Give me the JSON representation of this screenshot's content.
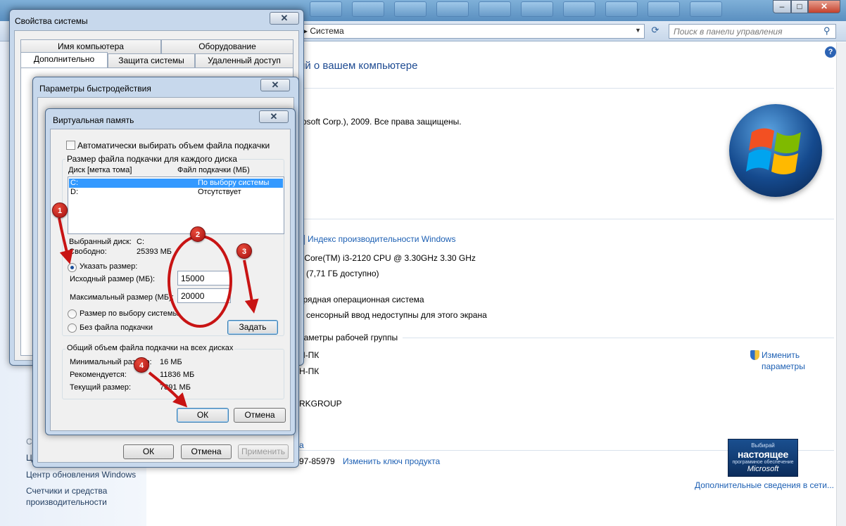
{
  "control_panel": {
    "address_breadcrumb": "▸ Система",
    "search_placeholder": "Поиск в панели управления",
    "heading_fragment": "ий о вашем компьютере",
    "copyright_fragment": "rosoft Corp.), 2009. Все права защищены.",
    "perf_index_link": "Индекс производительности Windows",
    "processor_fragment": ") Core(TM) i3-2120 CPU @ 3.30GHz   3.30 GHz",
    "ram_fragment": "5 (7,71 ГБ доступно)",
    "os_type_fragment": "зрядная операционная система",
    "pen_fragment": "и сенсорный ввод недоступны для этого экрана",
    "workgroup_section_fragment": "раметры рабочей группы",
    "computer_name_fragment": "Н-ПК",
    "full_name_fragment": "Н-ПК",
    "workgroup_fragment": "RKGROUP",
    "change_settings_link_line1": "Изменить",
    "change_settings_link_line2": "параметры",
    "product_id_fragment": "97-85979",
    "change_key_link": "Изменить ключ продукта",
    "more_info_link": "Дополнительные сведения в сети...",
    "genuine_badge": {
      "line1": "Выбирай",
      "line2": "настоящее",
      "line3": "программное обеспечение",
      "line4": "Microsoft"
    },
    "sidebar": {
      "see_also_fragment": "См",
      "center_fragment": "Це",
      "windows_update": "Центр обновления Windows",
      "perf_tools_line1": "Счетчики и средства",
      "perf_tools_line2": "производительности"
    },
    "link_fragment": "а"
  },
  "system_properties": {
    "title": "Свойства системы",
    "tabs_row1": [
      "Имя компьютера",
      "Оборудование"
    ],
    "tabs_row2": [
      "Дополнительно",
      "Защита системы",
      "Удаленный доступ"
    ],
    "buttons": {
      "ok": "ОК",
      "cancel": "Отмена",
      "apply": "Применить"
    }
  },
  "performance_options": {
    "title": "Параметры быстродействия"
  },
  "virtual_memory": {
    "title": "Виртуальная память",
    "auto_checkbox_label": "Автоматически выбирать объем файла подкачки",
    "auto_checked": false,
    "per_drive_group_label": "Размер файла подкачки для каждого диска",
    "col_drive": "Диск [метка тома]",
    "col_pagefile": "Файл подкачки (МБ)",
    "drives": [
      {
        "drive": "C:",
        "pagefile": "По выбору системы",
        "selected": true
      },
      {
        "drive": "D:",
        "pagefile": "Отсутствует",
        "selected": false
      }
    ],
    "selected_drive_label": "Выбранный диск:",
    "selected_drive_value": "C:",
    "free_label": "Свободно:",
    "free_value": "25393 МБ",
    "custom_size_label": "Указать размер:",
    "initial_size_label": "Исходный размер (МБ):",
    "initial_size_value": "15000",
    "max_size_label": "Максимальный размер (МБ):",
    "max_size_value": "20000",
    "system_managed_label": "Размер по выбору системы",
    "no_pagefile_label": "Без файла подкачки",
    "set_button": "Задать",
    "total_group_label": "Общий объем файла подкачки на всех дисках",
    "min_label": "Минимальный размер:",
    "min_value": "16 МБ",
    "recommended_label": "Рекомендуется:",
    "recommended_value": "11836 МБ",
    "current_label": "Текущий размер:",
    "current_value": "7891 МБ",
    "ok_button": "ОК",
    "cancel_button": "Отмена"
  },
  "annotations": {
    "badges": [
      "1",
      "2",
      "3",
      "4"
    ],
    "accent_color": "#c81414"
  }
}
